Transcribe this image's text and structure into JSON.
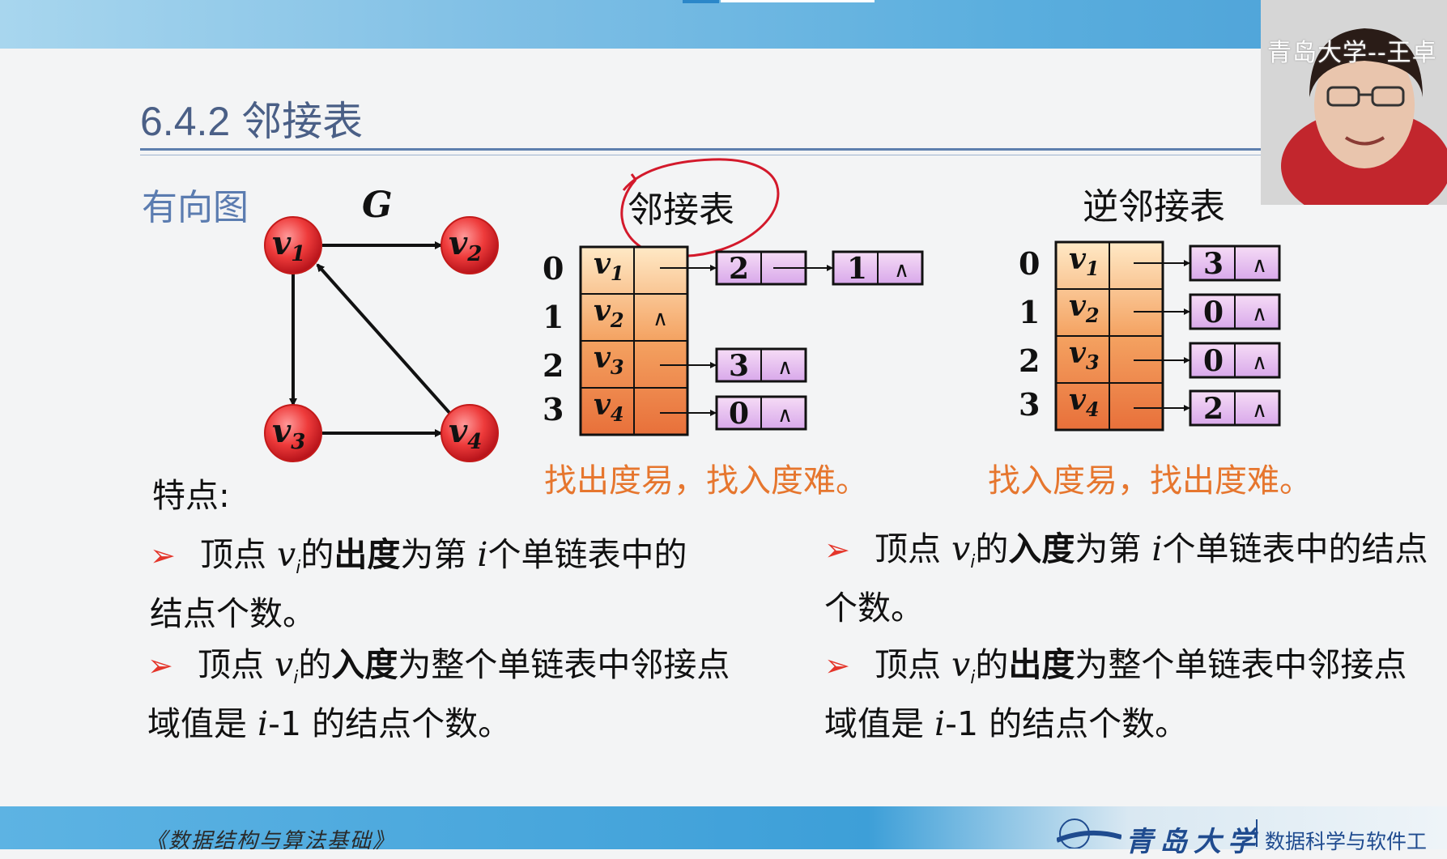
{
  "header": {
    "title": "6.4.2 邻接表"
  },
  "footer": {
    "course": "《数据结构与算法基础》",
    "university": "青岛大学",
    "school": "数据科学与软件工"
  },
  "webcam": {
    "caption": "青岛大学--王卓"
  },
  "graph": {
    "label": "有向图",
    "name": "G",
    "vertices": [
      {
        "id": "v1",
        "base": "v",
        "sub": "1"
      },
      {
        "id": "v2",
        "base": "v",
        "sub": "2"
      },
      {
        "id": "v3",
        "base": "v",
        "sub": "3"
      },
      {
        "id": "v4",
        "base": "v",
        "sub": "4"
      }
    ],
    "edges": [
      [
        "v1",
        "v2"
      ],
      [
        "v1",
        "v3"
      ],
      [
        "v3",
        "v4"
      ],
      [
        "v4",
        "v1"
      ]
    ]
  },
  "adjacency_list": {
    "title": "邻接表",
    "indices": [
      "0",
      "1",
      "2",
      "3"
    ],
    "vertices": [
      "v1",
      "v2",
      "v3",
      "v4"
    ],
    "lists": [
      [
        "2",
        "1"
      ],
      [],
      [
        "3"
      ],
      [
        "0"
      ]
    ],
    "null_symbol": "∧",
    "note": "找出度易，找入度难。"
  },
  "inverse_adjacency_list": {
    "title": "逆邻接表",
    "indices": [
      "0",
      "1",
      "2",
      "3"
    ],
    "vertices": [
      "v1",
      "v2",
      "v3",
      "v4"
    ],
    "lists": [
      [
        "3"
      ],
      [
        "0"
      ],
      [
        "0"
      ],
      [
        "2"
      ]
    ],
    "null_symbol": "∧",
    "note": "找入度易，找出度难。"
  },
  "features": {
    "label": "特点:",
    "left": [
      {
        "pre": "顶点 ",
        "v": "v",
        "sub": "i",
        "mid": "的",
        "bold": "出度",
        "post1": "为第 ",
        "iv": "i",
        "post2": "个单链表中的结点个数。"
      },
      {
        "pre": "顶点 ",
        "v": "v",
        "sub": "i",
        "mid": "的",
        "bold": "入度",
        "post1": "为整个单链表中邻接点域值是 ",
        "iv": "i",
        "post2": "-1  的结点个数。"
      }
    ],
    "right": [
      {
        "pre": "顶点 ",
        "v": "v",
        "sub": "i",
        "mid": "的",
        "bold": "入度",
        "post1": "为第 ",
        "iv": "i",
        "post2": "个单链表中的结点个数。"
      },
      {
        "pre": "顶点 ",
        "v": "v",
        "sub": "i",
        "mid": "的",
        "bold": "出度",
        "post1": "为整个单链表中邻接点域值是 ",
        "iv": "i",
        "post2": "-1 的结点个数。"
      }
    ]
  }
}
